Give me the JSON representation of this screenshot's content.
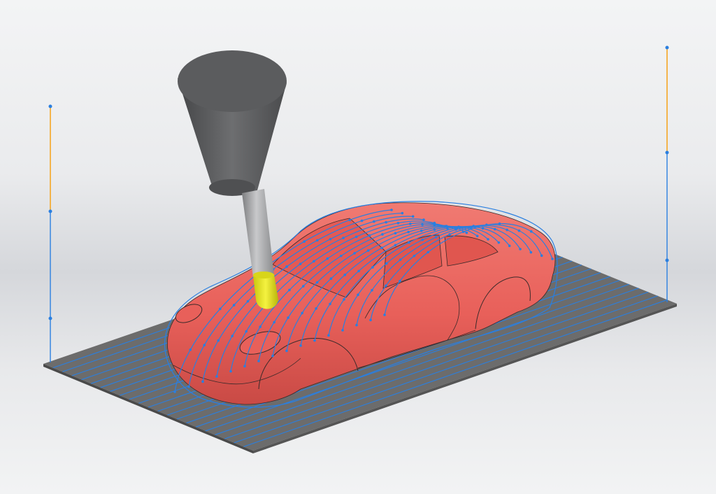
{
  "viewport": {
    "name": "cam-toolpath-simulation",
    "background_top": "#f3f4f5",
    "background_bottom": "#d5d7db"
  },
  "colors": {
    "stock_plate": "#6c6c6c",
    "car_body": "#e8605a",
    "car_shadow": "#c94a45",
    "toolpath": "#2a7fe0",
    "retract_move": "#f5a623",
    "tool_holder": "#5b5c5e",
    "tool_shank": "#a7a8aa",
    "tool_tip": "#e2e020"
  },
  "icons": [
    "cutting-tool-icon"
  ]
}
